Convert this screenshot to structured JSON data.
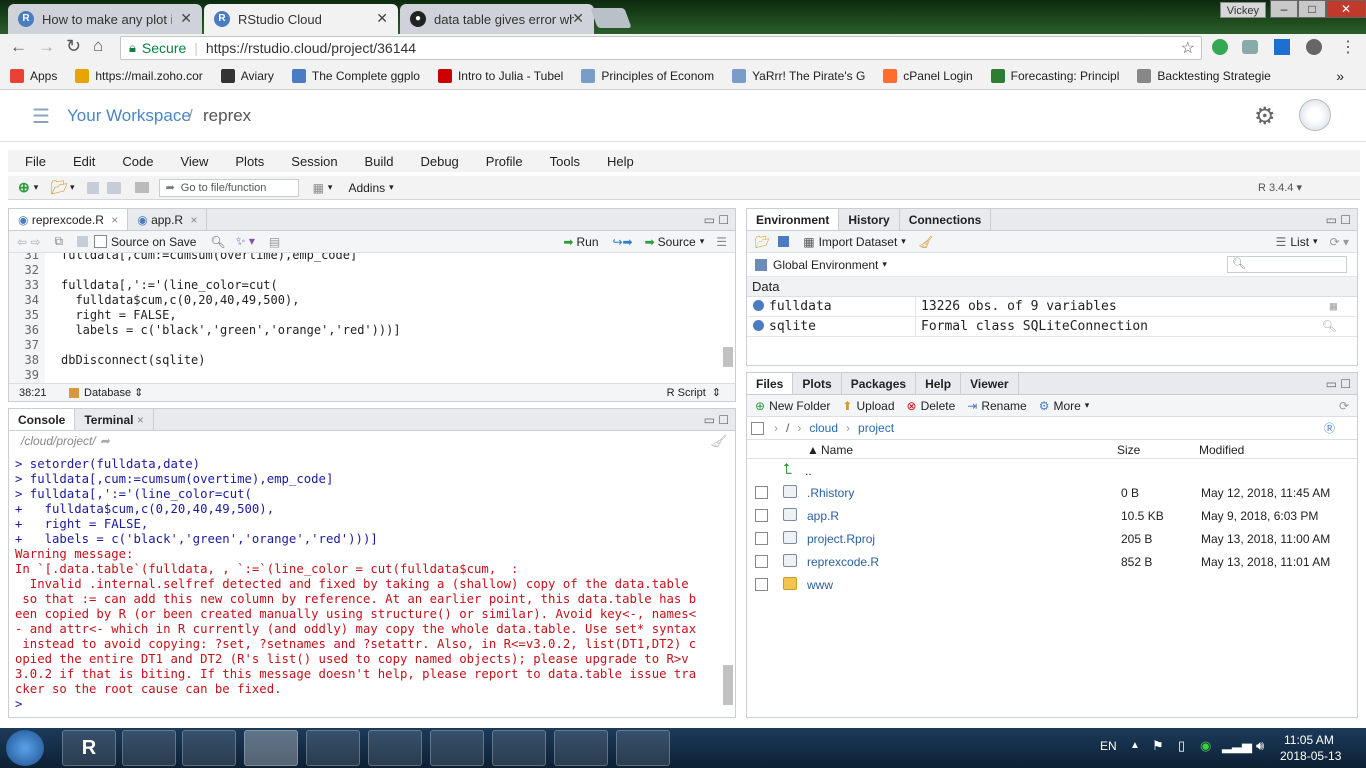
{
  "browser": {
    "tabs": [
      {
        "title": "How to make any plot in",
        "icon": "R"
      },
      {
        "title": "RStudio Cloud",
        "icon": "R"
      },
      {
        "title": "data table gives error wh",
        "icon": "github-icon"
      }
    ],
    "user_badge": "Vickey",
    "window_buttons": [
      "–",
      "□",
      "✕"
    ],
    "secure_label": "Secure",
    "url": "https://rstudio.cloud/project/36144",
    "bookmarks": [
      {
        "label": "Apps",
        "color": "#e94235"
      },
      {
        "label": "https://mail.zoho.cor",
        "color": "#e8a400"
      },
      {
        "label": "Aviary",
        "color": "#333333"
      },
      {
        "label": "The Complete ggplo",
        "color": "#4a7cc2"
      },
      {
        "label": "Intro to Julia - Tubel",
        "color": "#cc0000"
      },
      {
        "label": "Principles of Econom",
        "color": "#7a9cc8"
      },
      {
        "label": "YaRrr! The Pirate's G",
        "color": "#7a9cc8"
      },
      {
        "label": "cPanel Login",
        "color": "#ff6c2c"
      },
      {
        "label": "Forecasting: Principl",
        "color": "#2e7d32"
      },
      {
        "label": "Backtesting Strategie",
        "color": "#888888"
      }
    ],
    "more_bookmarks": "»"
  },
  "workspace": {
    "title": "Your Workspace",
    "separator": "/",
    "project": "reprex"
  },
  "menu": [
    "File",
    "Edit",
    "Code",
    "View",
    "Plots",
    "Session",
    "Build",
    "Debug",
    "Profile",
    "Tools",
    "Help"
  ],
  "toolbar": {
    "goto_placeholder": "Go to file/function",
    "addins": "Addins",
    "r_version": "R 3.4.4"
  },
  "editor": {
    "tabs": [
      "reprexcode.R",
      "app.R"
    ],
    "source_on_save": "Source on Save",
    "run": "Run",
    "source": "Source",
    "lines": [
      {
        "n": "31",
        "text": "fulldata[,cum:=cumsum(overtime),emp_code]"
      },
      {
        "n": "32",
        "text": ""
      },
      {
        "n": "33",
        "text": "fulldata[,':='(line_color=cut("
      },
      {
        "n": "34",
        "text": "  fulldata$cum,c(0,20,40,49,500),"
      },
      {
        "n": "35",
        "text": "  right = FALSE,"
      },
      {
        "n": "36",
        "text": "  labels = c('black','green','orange','red')))]"
      },
      {
        "n": "37",
        "text": ""
      },
      {
        "n": "38",
        "text": "dbDisconnect(sqlite)"
      },
      {
        "n": "39",
        "text": ""
      }
    ],
    "status_pos": "38:21",
    "status_scope": "Database",
    "status_type": "R Script"
  },
  "console": {
    "tabs": [
      "Console",
      "Terminal"
    ],
    "path": "/cloud/project/",
    "lines": [
      {
        "cls": "blue",
        "text": "> setorder(fulldata,date)"
      },
      {
        "cls": "blue",
        "text": "> fulldata[,cum:=cumsum(overtime),emp_code]"
      },
      {
        "cls": "blue",
        "text": "> fulldata[,':='(line_color=cut("
      },
      {
        "cls": "blue",
        "text": "+   fulldata$cum,c(0,20,40,49,500),"
      },
      {
        "cls": "blue",
        "text": "+   right = FALSE,"
      },
      {
        "cls": "blue",
        "text": "+   labels = c('black','green','orange','red')))]"
      },
      {
        "cls": "red",
        "text": "Warning message:"
      },
      {
        "cls": "red",
        "text": "In `[.data.table`(fulldata, , `:=`(line_color = cut(fulldata$cum,  :"
      },
      {
        "cls": "red",
        "text": "  Invalid .internal.selfref detected and fixed by taking a (shallow) copy of the data.table"
      },
      {
        "cls": "red",
        "text": " so that := can add this new column by reference. At an earlier point, this data.table has b"
      },
      {
        "cls": "red",
        "text": "een copied by R (or been created manually using structure() or similar). Avoid key<-, names<"
      },
      {
        "cls": "red",
        "text": "- and attr<- which in R currently (and oddly) may copy the whole data.table. Use set* syntax"
      },
      {
        "cls": "red",
        "text": " instead to avoid copying: ?set, ?setnames and ?setattr. Also, in R<=v3.0.2, list(DT1,DT2) c"
      },
      {
        "cls": "red",
        "text": "opied the entire DT1 and DT2 (R's list() used to copy named objects); please upgrade to R>v"
      },
      {
        "cls": "red",
        "text": "3.0.2 if that is biting. If this message doesn't help, please report to data.table issue tra"
      },
      {
        "cls": "red",
        "text": "cker so the root cause can be fixed."
      },
      {
        "cls": "blue",
        "text": "> "
      }
    ]
  },
  "environment": {
    "tabs": [
      "Environment",
      "History",
      "Connections"
    ],
    "import_dataset": "Import Dataset",
    "list_label": "List",
    "global_env": "Global Environment",
    "section": "Data",
    "rows": [
      {
        "name": "fulldata",
        "value": "13226 obs. of 9 variables"
      },
      {
        "name": "sqlite",
        "value": "Formal class SQLiteConnection"
      }
    ]
  },
  "files": {
    "tabs": [
      "Files",
      "Plots",
      "Packages",
      "Help",
      "Viewer"
    ],
    "actions": [
      "New Folder",
      "Upload",
      "Delete",
      "Rename",
      "More"
    ],
    "breadcrumb": [
      "cloud",
      "project"
    ],
    "headers": {
      "name": "Name",
      "size": "Size",
      "modified": "Modified"
    },
    "up": "..",
    "rows": [
      {
        "name": ".Rhistory",
        "size": "0 B",
        "modified": "May 12, 2018, 11:45 AM",
        "icon": "history-file-icon"
      },
      {
        "name": "app.R",
        "size": "10.5 KB",
        "modified": "May 9, 2018, 6:03 PM",
        "icon": "r-file-icon"
      },
      {
        "name": "project.Rproj",
        "size": "205 B",
        "modified": "May 13, 2018, 11:00 AM",
        "icon": "rproj-file-icon"
      },
      {
        "name": "reprexcode.R",
        "size": "852 B",
        "modified": "May 13, 2018, 11:01 AM",
        "icon": "r-file-icon"
      },
      {
        "name": "www",
        "size": "",
        "modified": "",
        "icon": "folder-icon"
      }
    ]
  },
  "taskbar": {
    "lang": "EN",
    "time": "11:05 AM",
    "date": "2018-05-13"
  }
}
